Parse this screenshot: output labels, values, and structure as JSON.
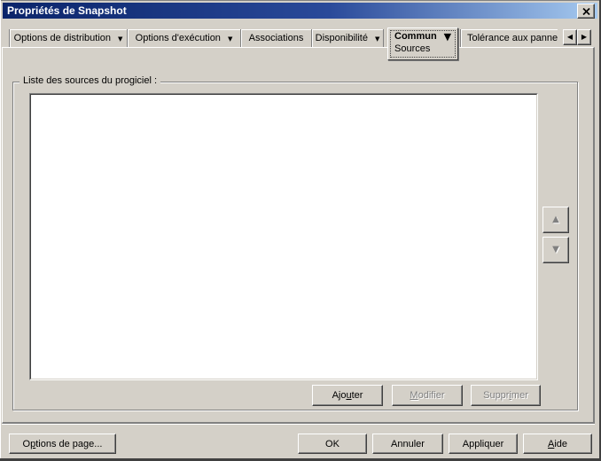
{
  "titlebar": {
    "title": "Propriétés de Snapshot",
    "close_icon": "x-mark"
  },
  "tabs": [
    {
      "label": "Options de distribution",
      "dropdown": true
    },
    {
      "label": "Options d'exécution",
      "dropdown": true
    },
    {
      "label": "Associations",
      "dropdown": false
    },
    {
      "label": "Disponibilité",
      "dropdown": true
    },
    {
      "label": "Commun",
      "dropdown": true,
      "active": true,
      "subpage": "Sources"
    },
    {
      "label": "Tolérance aux panne",
      "dropdown": false,
      "truncated": true
    }
  ],
  "icons": {
    "dropdown": "▼",
    "scroll_left": "◀",
    "scroll_right": "▶",
    "move_up": "▲",
    "move_down": "▼"
  },
  "main": {
    "group_title": "Liste des sources du progiciel :",
    "source_list": {
      "items": []
    },
    "add_button": {
      "pre": "Ajo",
      "key": "u",
      "post": "ter",
      "enabled": true
    },
    "modify_button": {
      "pre": "",
      "key": "M",
      "post": "odifier",
      "enabled": false
    },
    "delete_button": {
      "pre": "Suppr",
      "key": "i",
      "post": "mer",
      "enabled": false
    }
  },
  "footer": {
    "page_options_button": {
      "pre": "O",
      "key": "p",
      "post": "tions de page...",
      "enabled": true
    },
    "ok_label": "OK",
    "cancel_label": "Annuler",
    "apply_label": "Appliquer",
    "help_button": {
      "pre": "",
      "key": "A",
      "post": "ide"
    }
  },
  "colors": {
    "face": "#d4d0c8",
    "title_gradient_start": "#0a246a",
    "title_gradient_end": "#a6caf0",
    "title_text": "#ffffff",
    "list_background": "#ffffff",
    "disabled_text": "#808080",
    "border_dark": "#404040",
    "border_mid": "#808080"
  }
}
